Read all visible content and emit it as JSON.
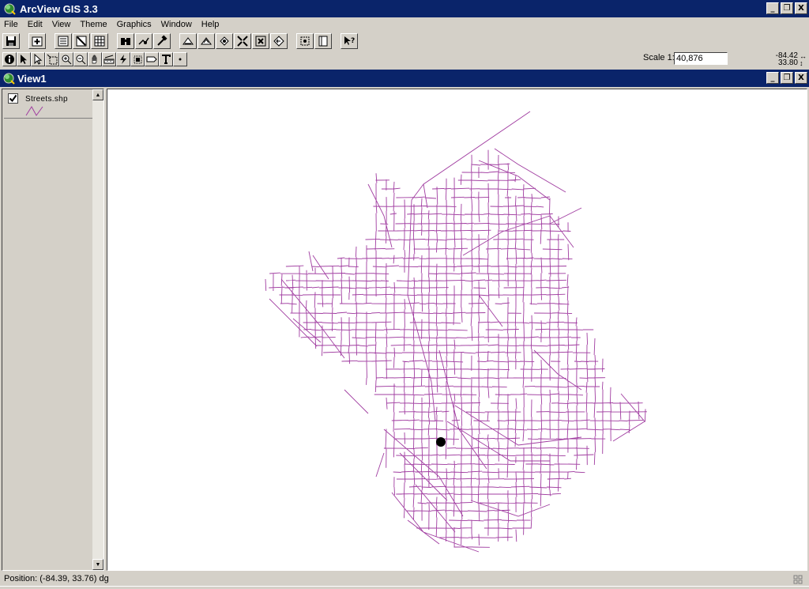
{
  "app": {
    "title": "ArcView GIS 3.3"
  },
  "window_controls": {
    "minimize": "_",
    "restore": "❐",
    "close": "X"
  },
  "menu": [
    "File",
    "Edit",
    "View",
    "Theme",
    "Graphics",
    "Window",
    "Help"
  ],
  "toolbar1": [
    "save-project",
    "add-theme",
    "theme-properties",
    "edit-legend",
    "open-table",
    "find",
    "locate-address",
    "query-builder",
    "zoom-full-extent",
    "zoom-active-themes",
    "zoom-selected",
    "zoom-in",
    "zoom-out",
    "zoom-previous",
    "select-by-theme",
    "layout",
    "help"
  ],
  "toolbar2": [
    "identify",
    "pointer",
    "vertex-edit",
    "select-feature",
    "zoom-in-tool",
    "zoom-out-tool",
    "pan",
    "measure",
    "hotlink",
    "area-of-interest",
    "label",
    "text",
    "draw-point"
  ],
  "scale": {
    "label": "Scale 1:",
    "value": "40,876"
  },
  "cursor_coords": {
    "x": "-84.42",
    "y": "33.80"
  },
  "view": {
    "title": "View1"
  },
  "toc": {
    "theme_name": "Streets.shp",
    "visible": true,
    "line_color": "#a03ca0"
  },
  "map": {
    "street_color": "#a03ca0",
    "marker_color": "#000000"
  },
  "status": {
    "position": "Position: (-84.39, 33.76) dg"
  }
}
